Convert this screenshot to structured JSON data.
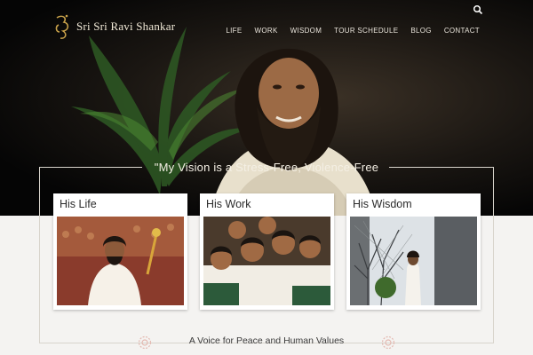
{
  "header": {
    "logo_text": "Sri Sri Ravi Shankar",
    "icons": {
      "logo": "om-logo-icon",
      "search": "search-icon"
    }
  },
  "nav": {
    "items": [
      {
        "label": "LIFE"
      },
      {
        "label": "WORK"
      },
      {
        "label": "WISDOM"
      },
      {
        "label": "TOUR SCHEDULE"
      },
      {
        "label": "BLOG"
      },
      {
        "label": "CONTACT"
      }
    ]
  },
  "hero": {
    "quote": "\"My Vision is a Stress-Free, Violence-Free"
  },
  "cards": [
    {
      "title": "His Life"
    },
    {
      "title": "His Work"
    },
    {
      "title": "His Wisdom"
    }
  ],
  "footer": {
    "tagline": "A Voice for Peace and Human Values"
  },
  "colors": {
    "hero_background": "#0a0908",
    "page_background": "#f4f3f1",
    "logo_gold": "#c9a24a",
    "frame_line": "#d8d4cc",
    "ornament": "#e3b8b0"
  }
}
